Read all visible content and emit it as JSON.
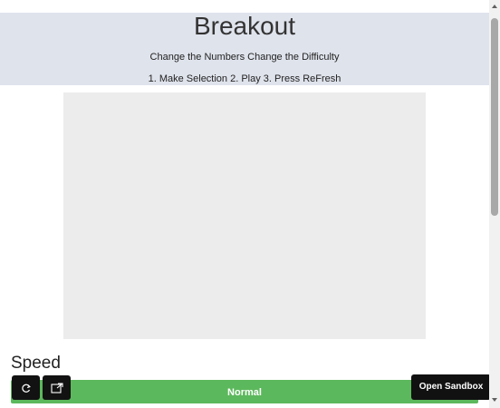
{
  "header": {
    "title": "Breakout",
    "subtitle": "Change the Numbers Change the Difficulty",
    "steps": "1. Make Selection 2. Play 3. Press ReFresh"
  },
  "speed": {
    "label": "Speed",
    "selected": "Normal"
  },
  "toolbar": {
    "sandbox_label": "Open Sandbox",
    "icons": [
      "refresh-icon",
      "open-external-icon"
    ]
  },
  "colors": {
    "header_bg": "#dfe3ec",
    "canvas_bg": "#ececec",
    "speed_bar": "#5cb85c",
    "buttons": "#111111"
  }
}
